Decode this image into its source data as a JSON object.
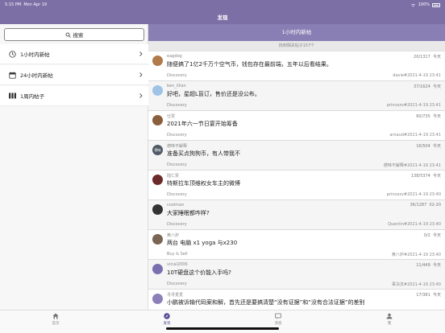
{
  "status_bar": {
    "time": "5:15 PM",
    "date": "Mon Apr 19",
    "battery": "100%"
  },
  "navbar": {
    "title": "发现"
  },
  "sidebar": {
    "search_label": "搜索",
    "items": [
      {
        "label": "1小时内新帖",
        "icon": "clock-icon"
      },
      {
        "label": "24小时内新帖",
        "icon": "calendar-icon"
      },
      {
        "label": "1周内帖子",
        "icon": "columns-icon"
      }
    ]
  },
  "detail": {
    "title": "1小时内新帖",
    "subheader": "找到相关帖子157个",
    "posts": [
      {
        "author": "eagdog",
        "stats": "20/1317",
        "time": "今天",
        "title": "随便搞了1亿2千万个空气币，钱包存在最前端，五年以后看结果。",
        "node": "Discovery",
        "reply": "davie#2021-4-19 23:41",
        "avatar_color": "#b07a4a",
        "avatar_text": ""
      },
      {
        "author": "ben_illian",
        "stats": "37/1624",
        "time": "今天",
        "title": "好吧，星超L盲订，售价还是没公布。",
        "node": "Discovery",
        "reply": "princezv#2021-4-19 23:41",
        "avatar_color": "#9ec3e6",
        "avatar_text": ""
      },
      {
        "author": "仕贾",
        "stats": "60/735",
        "time": "今天",
        "title": "2021年六一节日宴开始筹备",
        "node": "Discovery",
        "reply": "arnaud#2021-4-19 23:41",
        "avatar_color": "#8b5e3c",
        "avatar_text": ""
      },
      {
        "author": "德味不解释",
        "stats": "16/504",
        "time": "今天",
        "title": "准备买点狗狗币，有人带我不",
        "node": "Discovery",
        "reply": "德味不解释#2021-4-19 23:41",
        "avatar_color": "#4f5a66",
        "avatar_text": "德味"
      },
      {
        "author": "陆仁贾",
        "stats": "138/5374",
        "time": "今天",
        "title": "特斯拉车顶维权女车主的微博",
        "node": "Discovery",
        "reply": "princezv#2021-4-19 23:40",
        "avatar_color": "#6b2a2a",
        "avatar_text": ""
      },
      {
        "author": "coolman",
        "stats": "36/1287",
        "time": "02-20",
        "title": "大家睡眠都咋样?",
        "node": "Discovery",
        "reply": "Quentin#2021-4-19 23:40",
        "avatar_color": "#333333",
        "avatar_text": ""
      },
      {
        "author": "黄八炉",
        "stats": "0/2",
        "time": "今天",
        "title": "两台 电脑 x1 yoga 与x230",
        "node": "Buy & Sell",
        "reply": "黄八炉#2021-4-19 23:40",
        "avatar_color": "#7a6452",
        "avatar_text": ""
      },
      {
        "author": "vicial2006",
        "stats": "11/449",
        "time": "今天",
        "title": "10T硬盘这个价能入手吗?",
        "node": "Discovery",
        "reply": "事决法#2021-4-19 23:40",
        "avatar_color": "#7a70b0",
        "avatar_text": ""
      },
      {
        "author": "寻寻觅觅",
        "stats": "17/381",
        "time": "今天",
        "title": "小鹏被诉输代码案和解，首先还是要搞清楚“没有证据”和“没有合法证据”的差别",
        "node": "",
        "reply": "",
        "avatar_color": "#8c80b8",
        "avatar_text": ""
      }
    ]
  },
  "tabbar": {
    "tabs": [
      {
        "label": "首页",
        "icon": "home-icon",
        "active": false
      },
      {
        "label": "发现",
        "icon": "compass-icon",
        "active": true
      },
      {
        "label": "消息",
        "icon": "message-icon",
        "active": false
      },
      {
        "label": "我",
        "icon": "person-icon",
        "active": false
      }
    ]
  },
  "colors": {
    "accent": "#7b6fa6",
    "header": "#8a7fb5",
    "active_tab": "#5b4e94"
  }
}
